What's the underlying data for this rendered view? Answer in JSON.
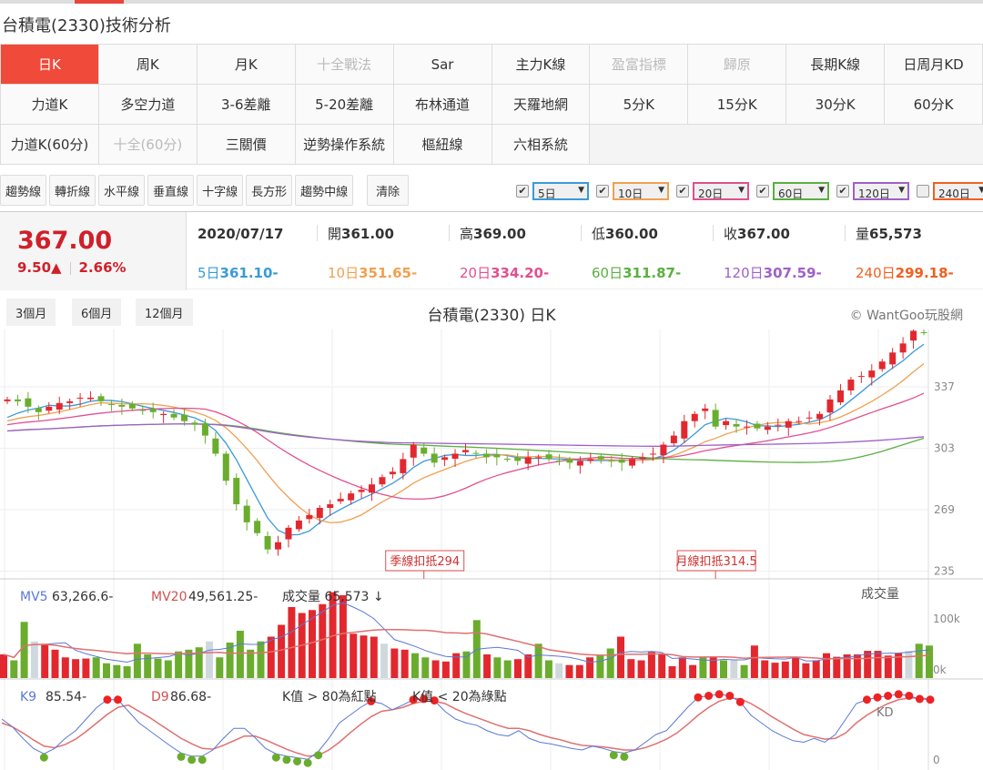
{
  "title": "台積電(2330)技術分析",
  "tabs": [
    {
      "label": "日K",
      "state": "active"
    },
    {
      "label": "周K"
    },
    {
      "label": "月K"
    },
    {
      "label": "十全戰法",
      "state": "disabled"
    },
    {
      "label": "Sar"
    },
    {
      "label": "主力K線"
    },
    {
      "label": "盈富指標",
      "state": "disabled"
    },
    {
      "label": "歸原",
      "state": "disabled"
    },
    {
      "label": "長期K線"
    },
    {
      "label": "日周月KD"
    },
    {
      "label": "力道K"
    },
    {
      "label": "多空力道"
    },
    {
      "label": "3-6差離"
    },
    {
      "label": "5-20差離"
    },
    {
      "label": "布林通道"
    },
    {
      "label": "天羅地網"
    },
    {
      "label": "5分K"
    },
    {
      "label": "15分K"
    },
    {
      "label": "30分K"
    },
    {
      "label": "60分K"
    },
    {
      "label": "力道K(60分)"
    },
    {
      "label": "十全(60分)",
      "state": "disabled"
    },
    {
      "label": "三關價"
    },
    {
      "label": "逆勢操作系統"
    },
    {
      "label": "樞紐線"
    },
    {
      "label": "六相系統"
    }
  ],
  "tools": [
    "趨勢線",
    "轉折線",
    "水平線",
    "垂直線",
    "十字線",
    "長方形",
    "趨勢中線"
  ],
  "clear": "清除",
  "ma_selects": [
    {
      "label": "5日",
      "checked": true,
      "color": "#3a9ad9"
    },
    {
      "label": "10日",
      "checked": true,
      "color": "#f0a050"
    },
    {
      "label": "20日",
      "checked": true,
      "color": "#e05090"
    },
    {
      "label": "60日",
      "checked": true,
      "color": "#5ab040"
    },
    {
      "label": "120日",
      "checked": true,
      "color": "#a060c8"
    },
    {
      "label": "240日",
      "checked": false,
      "color": "#f06020"
    }
  ],
  "quote": {
    "price": "367.00",
    "change": "9.50▲",
    "pct": "2.66%",
    "date": "2020/07/17",
    "open_l": "開",
    "open": "361.00",
    "high_l": "高",
    "high": "369.00",
    "low_l": "低",
    "low": "360.00",
    "close_l": "收",
    "close": "367.00",
    "vol_l": "量",
    "vol": "65,573"
  },
  "ma_values": [
    {
      "label": "5日",
      "value": "361.10-",
      "color": "#3a9ad9"
    },
    {
      "label": "10日",
      "value": "351.65-",
      "color": "#f0a050"
    },
    {
      "label": "20日",
      "value": "334.20-",
      "color": "#e05090"
    },
    {
      "label": "60日",
      "value": "311.87-",
      "color": "#5ab040"
    },
    {
      "label": "120日",
      "value": "307.59-",
      "color": "#a060c8"
    },
    {
      "label": "240日",
      "value": "299.18-",
      "color": "#f06020"
    }
  ],
  "ranges": [
    "3個月",
    "6個月",
    "12個月"
  ],
  "chart_title": "台積電(2330) 日K",
  "copyright": "© WantGoo玩股網",
  "chart_data": {
    "type": "candlestick",
    "y_ticks": [
      337,
      303,
      269,
      235
    ],
    "ylim": [
      230,
      378
    ],
    "closes": [
      330,
      329,
      326,
      323,
      326,
      328,
      329,
      331,
      331,
      329,
      327,
      326,
      325,
      324,
      323,
      322,
      320,
      318,
      316,
      310,
      300,
      285,
      272,
      262,
      256,
      247,
      251,
      259,
      263,
      266,
      270,
      272,
      275,
      278,
      280,
      283,
      287,
      290,
      297,
      305,
      300,
      295,
      298,
      300,
      302,
      300,
      298,
      298,
      297,
      296,
      298,
      298,
      297,
      296,
      295,
      296,
      297,
      297,
      296,
      295,
      297,
      298,
      300,
      305,
      310,
      318,
      322,
      325,
      315,
      318,
      315,
      315,
      314,
      315,
      316,
      318,
      318,
      320,
      322,
      330,
      335,
      341,
      343,
      346,
      351,
      356,
      361,
      368,
      367
    ],
    "annotations": [
      {
        "label": "季線扣抵294",
        "index": 40
      },
      {
        "label": "月線扣抵314.5",
        "index": 68
      }
    ],
    "volume_title": "成交量",
    "volume_ticks": [
      "100k",
      "0k"
    ],
    "volume_legend": {
      "mv5_l": "MV5",
      "mv5": "63,266.6-",
      "mv20_l": "MV20",
      "mv20": "49,561.25-",
      "vol": "成交量 65,573 ↓"
    },
    "volume_k": [
      40,
      30,
      95,
      62,
      58,
      48,
      35,
      32,
      33,
      35,
      25,
      22,
      20,
      58,
      40,
      33,
      30,
      45,
      48,
      52,
      62,
      35,
      60,
      80,
      48,
      62,
      70,
      90,
      120,
      110,
      115,
      125,
      145,
      140,
      75,
      72,
      70,
      58,
      50,
      48,
      42,
      35,
      30,
      28,
      42,
      45,
      98,
      40,
      35,
      30,
      32,
      40,
      58,
      30,
      25,
      22,
      22,
      35,
      38,
      50,
      70,
      32,
      30,
      44,
      40,
      20,
      35,
      22,
      36,
      36,
      30,
      30,
      22,
      55,
      30,
      26,
      28,
      36,
      25,
      30,
      42,
      36,
      40,
      40,
      46,
      46,
      38,
      42,
      46,
      58,
      55
    ],
    "kd_legend": {
      "k_l": "K9",
      "k": "85.54-",
      "d_l": "D9",
      "d": "86.68-",
      "red_rule": "K值 > 80為紅點",
      "green_rule": "K值 < 20為綠點",
      "label": "KD"
    },
    "kd_ticks": [
      "0"
    ],
    "k": [
      60,
      50,
      35,
      22,
      15,
      22,
      35,
      45,
      60,
      75,
      85,
      85,
      70,
      55,
      45,
      35,
      25,
      16,
      12,
      12,
      20,
      35,
      48,
      48,
      36,
      22,
      15,
      12,
      10,
      8,
      18,
      35,
      55,
      65,
      75,
      83,
      80,
      72,
      78,
      85,
      86,
      84,
      70,
      60,
      55,
      52,
      45,
      40,
      38,
      45,
      35,
      30,
      28,
      25,
      22,
      20,
      25,
      22,
      18,
      16,
      20,
      30,
      40,
      45,
      60,
      75,
      88,
      90,
      92,
      90,
      82,
      65,
      55,
      45,
      38,
      32,
      30,
      35,
      30,
      40,
      60,
      80,
      85,
      88,
      90,
      92,
      90,
      86,
      85
    ],
    "d": [
      55,
      50,
      42,
      33,
      25,
      23,
      27,
      34,
      44,
      55,
      66,
      75,
      78,
      70,
      62,
      53,
      44,
      35,
      28,
      22,
      21,
      26,
      32,
      38,
      38,
      33,
      27,
      21,
      16,
      12,
      13,
      20,
      30,
      42,
      53,
      63,
      70,
      72,
      75,
      80,
      83,
      83,
      80,
      73,
      67,
      62,
      57,
      52,
      48,
      48,
      45,
      40,
      36,
      33,
      29,
      26,
      25,
      24,
      22,
      20,
      20,
      23,
      28,
      34,
      42,
      53,
      65,
      75,
      83,
      87,
      86,
      80,
      72,
      63,
      55,
      47,
      40,
      37,
      34,
      35,
      42,
      55,
      65,
      73,
      80,
      85,
      87,
      87,
      86
    ]
  }
}
